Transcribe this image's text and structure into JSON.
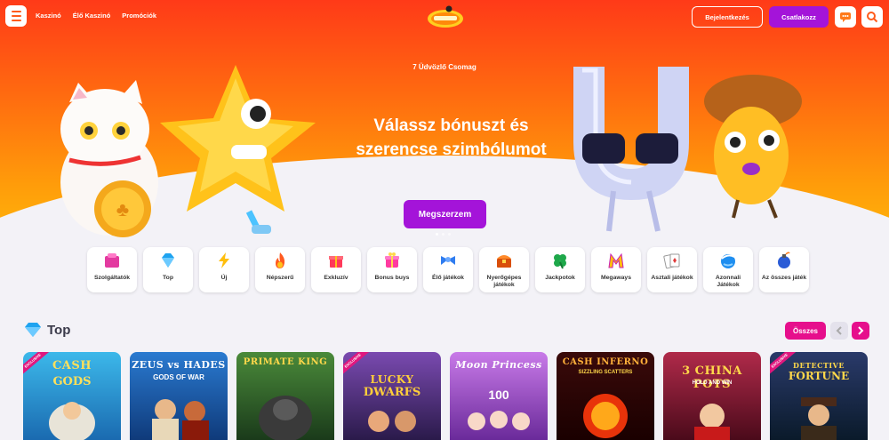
{
  "header": {
    "nav": [
      "Kaszinó",
      "Élő Kaszinó",
      "Promóciók"
    ],
    "login_label": "Bejelentkezés",
    "join_label": "Csatlakozz"
  },
  "hero": {
    "subtitle": "7 Üdvözlő Csomag",
    "title_line1": "Válassz bónuszt és",
    "title_line2": "szerencse szimbólumot",
    "cta": "Megszerzem",
    "slides": 3,
    "active_slide": 1
  },
  "categories": [
    {
      "label": "Szolgáltatók",
      "icon": "providers-icon",
      "color": "#e33aa0"
    },
    {
      "label": "Top",
      "icon": "diamond-icon",
      "color": "#1ea3f0"
    },
    {
      "label": "Új",
      "icon": "lightning-icon",
      "color": "#ffbe0b"
    },
    {
      "label": "Népszerű",
      "icon": "fire-icon",
      "color": "#ff5a1f"
    },
    {
      "label": "Exkluzív",
      "icon": "gift-icon",
      "color": "#ff3a5a"
    },
    {
      "label": "Bonus buys",
      "icon": "giftbox-icon",
      "color": "#ff3aa0"
    },
    {
      "label": "Élő játékok",
      "icon": "ribbon-icon",
      "color": "#2f7cf0"
    },
    {
      "label": "Nyerőgépes játékok",
      "icon": "treasure-chest-icon",
      "color": "#d94f0a"
    },
    {
      "label": "Jackpotok",
      "icon": "clover-icon",
      "color": "#1ea84a"
    },
    {
      "label": "Megaways",
      "icon": "m-letter-icon",
      "color": "#c81eb4"
    },
    {
      "label": "Asztali játékok",
      "icon": "cards-icon",
      "color": "#e03a3a"
    },
    {
      "label": "Azonnali Játékok",
      "icon": "globe-icon",
      "color": "#1e8ef0"
    },
    {
      "label": "Az összes játék",
      "icon": "bomb-icon",
      "color": "#2a5bd6"
    }
  ],
  "section": {
    "title": "Top",
    "all_label": "Összes"
  },
  "games": [
    {
      "title": "CASH",
      "subtitle": "GODS",
      "bg": "#2aa4d8",
      "badge": "EXCLUSIVE"
    },
    {
      "title": "ZEUS vs HADES",
      "subtitle": "GODS OF WAR",
      "bg": "#1c5fb8",
      "badge": ""
    },
    {
      "title": "PRIMATE KING",
      "subtitle": "",
      "bg": "#3a7a2a",
      "badge": ""
    },
    {
      "title": "LUCKY",
      "subtitle": "DWARFS",
      "bg": "#6a3a9a",
      "badge": "EXCLUSIVE"
    },
    {
      "title": "Moon Princess",
      "subtitle": "100",
      "bg": "#9a4cc8",
      "badge": ""
    },
    {
      "title": "CASH INFERNO",
      "subtitle": "SIZZLING SCATTERS",
      "bg": "#5a0a0a",
      "badge": ""
    },
    {
      "title": "3 CHINA POTS",
      "subtitle": "HOLD AND WIN",
      "bg": "#8a1a3a",
      "badge": ""
    },
    {
      "title": "DETECTIVE",
      "subtitle": "FORTUNE",
      "bg": "#1a2a4a",
      "badge": "EXCLUSIVE"
    }
  ]
}
